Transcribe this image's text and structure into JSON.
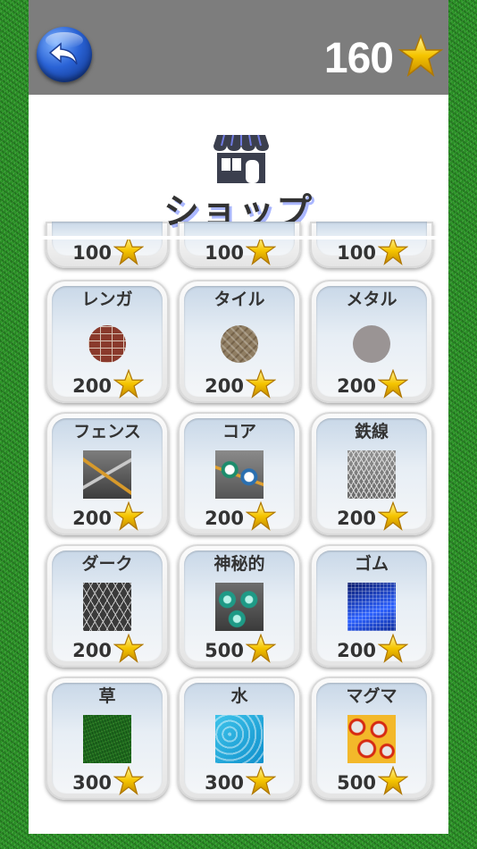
{
  "header": {
    "back_icon": "back-arrow-icon",
    "coins": "160",
    "coin_icon": "star-icon"
  },
  "shop": {
    "icon": "storefront-icon",
    "title": "ショップ"
  },
  "colors": {
    "background": "#2f9a2a",
    "topbar": "#7d7d7d",
    "panel": "#ffffff",
    "star": "#f5c400",
    "back_button": "#2a63d6",
    "title_shadow": "#aab7ff"
  },
  "top_row_partial": [
    {
      "price": "100"
    },
    {
      "price": "100"
    },
    {
      "price": "100"
    }
  ],
  "items": [
    {
      "name": "レンガ",
      "price": "200",
      "swatch": "brick-texture"
    },
    {
      "name": "タイル",
      "price": "200",
      "swatch": "tile-texture"
    },
    {
      "name": "メタル",
      "price": "200",
      "swatch": "metal-texture"
    },
    {
      "name": "フェンス",
      "price": "200",
      "swatch": "fence-texture"
    },
    {
      "name": "コア",
      "price": "200",
      "swatch": "core-texture"
    },
    {
      "name": "鉄線",
      "price": "200",
      "swatch": "wire-texture"
    },
    {
      "name": "ダーク",
      "price": "200",
      "swatch": "dark-texture"
    },
    {
      "name": "神秘的",
      "price": "500",
      "swatch": "mystic-texture"
    },
    {
      "name": "ゴム",
      "price": "200",
      "swatch": "rubber-texture"
    },
    {
      "name": "草",
      "price": "300",
      "swatch": "grass-texture"
    },
    {
      "name": "水",
      "price": "300",
      "swatch": "water-texture"
    },
    {
      "name": "マグマ",
      "price": "500",
      "swatch": "magma-texture"
    }
  ]
}
